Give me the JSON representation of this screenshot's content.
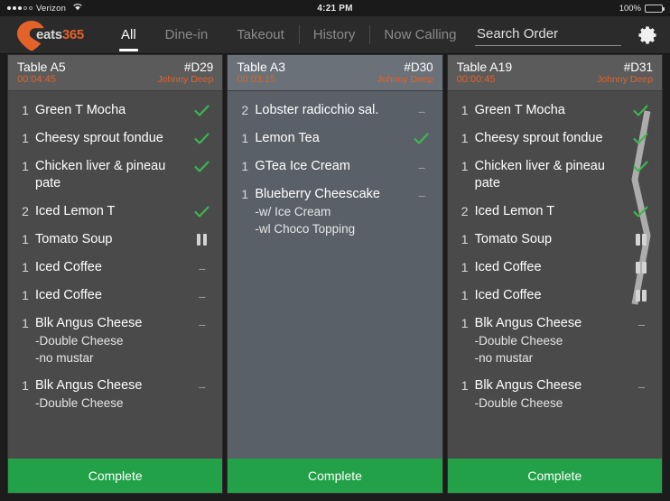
{
  "status_bar": {
    "carrier": "Verizon",
    "signal_dots_filled": 3,
    "signal_dots_total": 5,
    "wifi_icon": "wifi-icon",
    "time": "4:21 PM",
    "battery_percent": "100%"
  },
  "nav": {
    "logo_text_prefix": "eats",
    "logo_text_number": "365",
    "tabs": [
      {
        "label": "All",
        "active": true,
        "divider": false
      },
      {
        "label": "Dine-in",
        "active": false,
        "divider": false
      },
      {
        "label": "Takeout",
        "active": false,
        "divider": false
      },
      {
        "label": "History",
        "active": false,
        "divider": true
      },
      {
        "label": "Now Calling",
        "active": false,
        "divider": true
      }
    ],
    "search": {
      "value": "",
      "placeholder": "Search Order"
    },
    "settings_icon": "gear-icon"
  },
  "colors": {
    "accent_orange": "#e2622a",
    "complete_green": "#22a148",
    "check_green": "#3cb84f",
    "ticket_bg": "#4a4a4a",
    "ticket_bg_alt": "#5a6067"
  },
  "tickets": [
    {
      "table": "Table A5",
      "elapsed": "00:04:45",
      "order_no": "#D29",
      "server": "Johnny Deep",
      "highlighted": false,
      "complete_label": "Complete",
      "items": [
        {
          "qty": "1",
          "name": "Green T Mocha",
          "mods": [],
          "status": "check"
        },
        {
          "qty": "1",
          "name": "Cheesy sprout fondue",
          "mods": [],
          "status": "check"
        },
        {
          "qty": "1",
          "name": "Chicken liver & pineau pate",
          "mods": [],
          "status": "check"
        },
        {
          "qty": "2",
          "name": "Iced Lemon T",
          "mods": [],
          "status": "check"
        },
        {
          "qty": "1",
          "name": "Tomato Soup",
          "mods": [],
          "status": "pause"
        },
        {
          "qty": "1",
          "name": "Iced Coffee",
          "mods": [],
          "status": "dash"
        },
        {
          "qty": "1",
          "name": "Iced Coffee",
          "mods": [],
          "status": "dash"
        },
        {
          "qty": "1",
          "name": "Blk Angus Cheese",
          "mods": [
            "-Double Cheese",
            "-no mustar"
          ],
          "status": "dash"
        },
        {
          "qty": "1",
          "name": "Blk Angus Cheese",
          "mods": [
            "-Double Cheese"
          ],
          "status": "dash"
        }
      ]
    },
    {
      "table": "Table A3",
      "elapsed": "00:03:15",
      "order_no": "#D30",
      "server": "Johnny Deep",
      "highlighted": true,
      "complete_label": "Complete",
      "items": [
        {
          "qty": "2",
          "name": "Lobster radicchio sal.",
          "mods": [],
          "status": "dash"
        },
        {
          "qty": "1",
          "name": "Lemon Tea",
          "mods": [],
          "status": "check"
        },
        {
          "qty": "1",
          "name": "GTea Ice Cream",
          "mods": [],
          "status": "dash"
        },
        {
          "qty": "1",
          "name": "Blueberry Cheescake",
          "mods": [
            "-w/ Ice Cream",
            "-wl Choco Topping"
          ],
          "status": "dash"
        }
      ]
    },
    {
      "table": "Table A19",
      "elapsed": "00:00:45",
      "order_no": "#D31",
      "server": "Johnny Deep",
      "highlighted": false,
      "complete_label": "Complete",
      "items": [
        {
          "qty": "1",
          "name": "Green T Mocha",
          "mods": [],
          "status": "check"
        },
        {
          "qty": "1",
          "name": "Cheesy sprout fondue",
          "mods": [],
          "status": "check"
        },
        {
          "qty": "1",
          "name": "Chicken liver & pineau pate",
          "mods": [],
          "status": "check"
        },
        {
          "qty": "2",
          "name": "Iced Lemon T",
          "mods": [],
          "status": "check"
        },
        {
          "qty": "1",
          "name": "Tomato Soup",
          "mods": [],
          "status": "pause"
        },
        {
          "qty": "1",
          "name": "Iced Coffee",
          "mods": [],
          "status": "pause"
        },
        {
          "qty": "1",
          "name": "Iced Coffee",
          "mods": [],
          "status": "pause"
        },
        {
          "qty": "1",
          "name": "Blk Angus Cheese",
          "mods": [
            "-Double Cheese",
            "-no mustar"
          ],
          "status": "dash"
        },
        {
          "qty": "1",
          "name": "Blk Angus Cheese",
          "mods": [
            "-Double Cheese"
          ],
          "status": "dash"
        }
      ],
      "drag_trail": true
    }
  ]
}
